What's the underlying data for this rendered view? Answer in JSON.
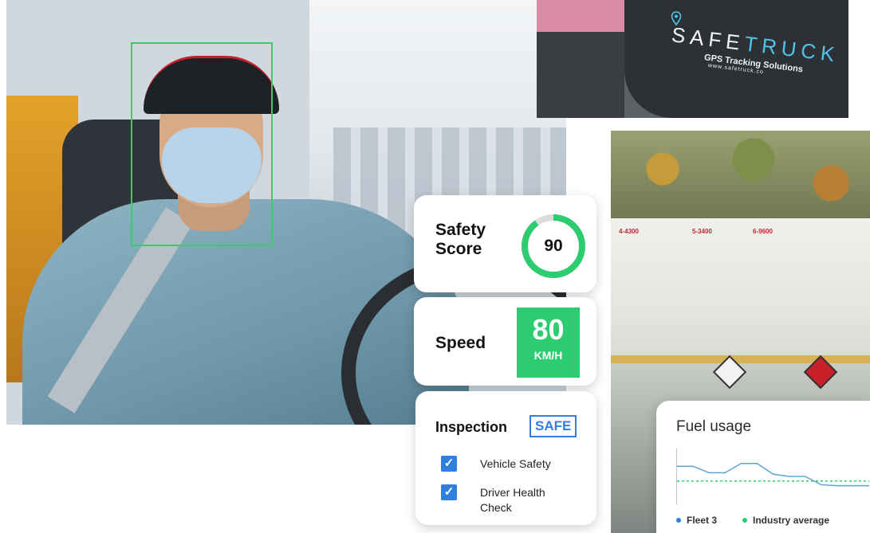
{
  "shirt": {
    "logo_s": "S",
    "logo_a": "A",
    "logo_fe": "FE",
    "logo_truck": "TRUCK",
    "tagline": "GPS Tracking Solutions",
    "url": "www.safetruck.co"
  },
  "tanker": {
    "compartments": [
      "4-4300",
      "5-3400",
      "6-9600"
    ]
  },
  "safety": {
    "label": "Safety Score",
    "score": "90",
    "score_fraction": 0.9,
    "ring_color": "#2ecc71"
  },
  "speed": {
    "label": "Speed",
    "value": "80",
    "unit": "KM/H",
    "box_color": "#2ecc71"
  },
  "inspection": {
    "label": "Inspection",
    "status": "SAFE",
    "accent": "#2f7ee0",
    "items": [
      {
        "label": "Vehicle Safety",
        "checked": true
      },
      {
        "label": "Driver Health Check",
        "checked": true
      }
    ]
  },
  "fuel": {
    "title": "Fuel usage",
    "legend": [
      {
        "label": "Fleet 3",
        "color": "#2f7ee0"
      },
      {
        "label": "Industry average",
        "color": "#2ecc71"
      }
    ]
  },
  "chart_data": {
    "type": "line",
    "title": "Fuel usage",
    "x": [
      0,
      1,
      2,
      3,
      4,
      5,
      6,
      7,
      8,
      9,
      10,
      11,
      12
    ],
    "series": [
      {
        "name": "Fleet 3",
        "color": "#5aa6d6",
        "values": [
          0.72,
          0.72,
          0.58,
          0.58,
          0.78,
          0.78,
          0.55,
          0.5,
          0.5,
          0.32,
          0.3,
          0.3,
          0.3
        ]
      },
      {
        "name": "Industry average",
        "color": "#2ecc71",
        "values": [
          0.4,
          0.4,
          0.4,
          0.4,
          0.4,
          0.4,
          0.4,
          0.4,
          0.4,
          0.4,
          0.4,
          0.4,
          0.4
        ]
      }
    ],
    "ylim": [
      0,
      1
    ],
    "grid": false,
    "legend": "bottom"
  }
}
